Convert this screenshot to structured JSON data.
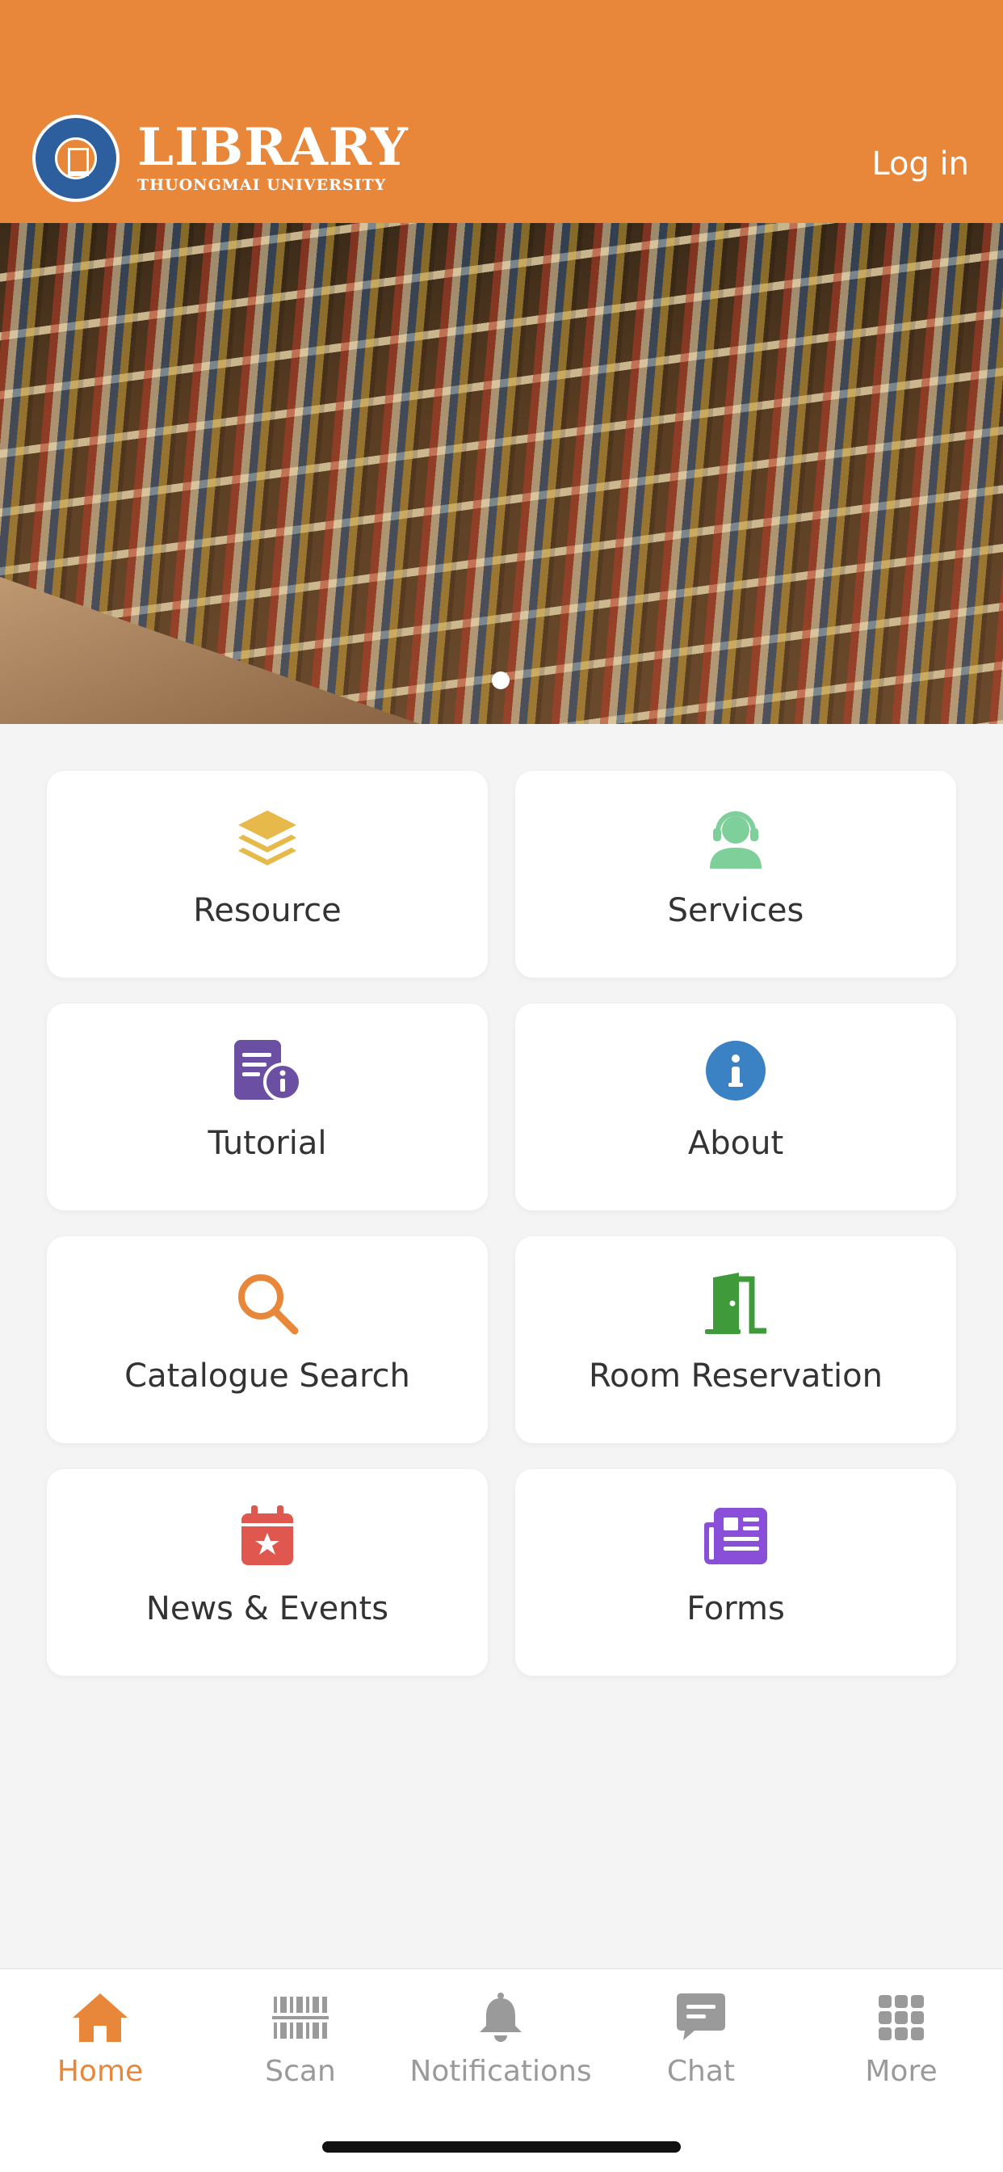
{
  "header": {
    "logo_title": "LIBRARY",
    "logo_subtitle": "THUONGMAI UNIVERSITY",
    "login_label": "Log in",
    "color": "#e8873a"
  },
  "banner": {
    "slide_count": 1,
    "active_slide": 1
  },
  "menu": [
    {
      "label": "Resource",
      "icon": "layers-icon",
      "color": "#e7b84a"
    },
    {
      "label": "Services",
      "icon": "support-agent-icon",
      "color": "#7fcf9a"
    },
    {
      "label": "Tutorial",
      "icon": "document-info-icon",
      "color": "#6b4fa3"
    },
    {
      "label": "About",
      "icon": "info-icon",
      "color": "#3b82c4"
    },
    {
      "label": "Catalogue Search",
      "icon": "search-icon",
      "color": "#e8873a"
    },
    {
      "label": "Room Reservation",
      "icon": "door-icon",
      "color": "#3f9a3a"
    },
    {
      "label": "News & Events",
      "icon": "calendar-star-icon",
      "color": "#e0574f"
    },
    {
      "label": "Forms",
      "icon": "newspaper-icon",
      "color": "#8a4fd8"
    }
  ],
  "tabbar": [
    {
      "label": "Home",
      "icon": "home-icon",
      "active": true
    },
    {
      "label": "Scan",
      "icon": "barcode-icon",
      "active": false
    },
    {
      "label": "Notifications",
      "icon": "bell-icon",
      "active": false
    },
    {
      "label": "Chat",
      "icon": "chat-icon",
      "active": false
    },
    {
      "label": "More",
      "icon": "grid-icon",
      "active": false
    }
  ]
}
